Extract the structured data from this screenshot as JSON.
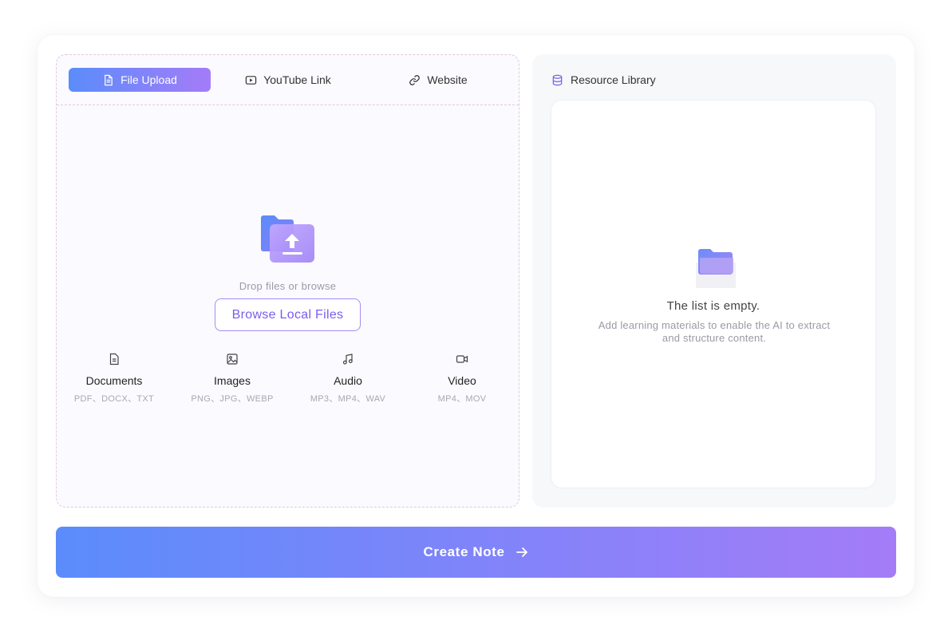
{
  "tabs": [
    {
      "label": "File Upload",
      "icon": "document-icon",
      "active": true
    },
    {
      "label": "YouTube Link",
      "icon": "youtube-icon",
      "active": false
    },
    {
      "label": "Website",
      "icon": "link-icon",
      "active": false
    }
  ],
  "upload": {
    "drop_text": "Drop files or browse",
    "browse_label": "Browse Local Files",
    "types": [
      {
        "name": "Documents",
        "formats": "PDF、DOCX、TXT",
        "icon": "document-icon"
      },
      {
        "name": "Images",
        "formats": "PNG、JPG、WEBP",
        "icon": "image-icon"
      },
      {
        "name": "Audio",
        "formats": "MP3、MP4、WAV",
        "icon": "music-note-icon"
      },
      {
        "name": "Video",
        "formats": "MP4、MOV",
        "icon": "video-camera-icon"
      }
    ]
  },
  "library": {
    "title": "Resource Library",
    "empty_title": "The list is empty.",
    "empty_desc": "Add learning materials to enable the AI to extract and structure content."
  },
  "create_label": "Create Note",
  "colors": {
    "gradient_start": "#5b8cfb",
    "gradient_end": "#a47cf8",
    "accent_text": "#7a5cf0",
    "dashed_border": "#e3c8da"
  }
}
